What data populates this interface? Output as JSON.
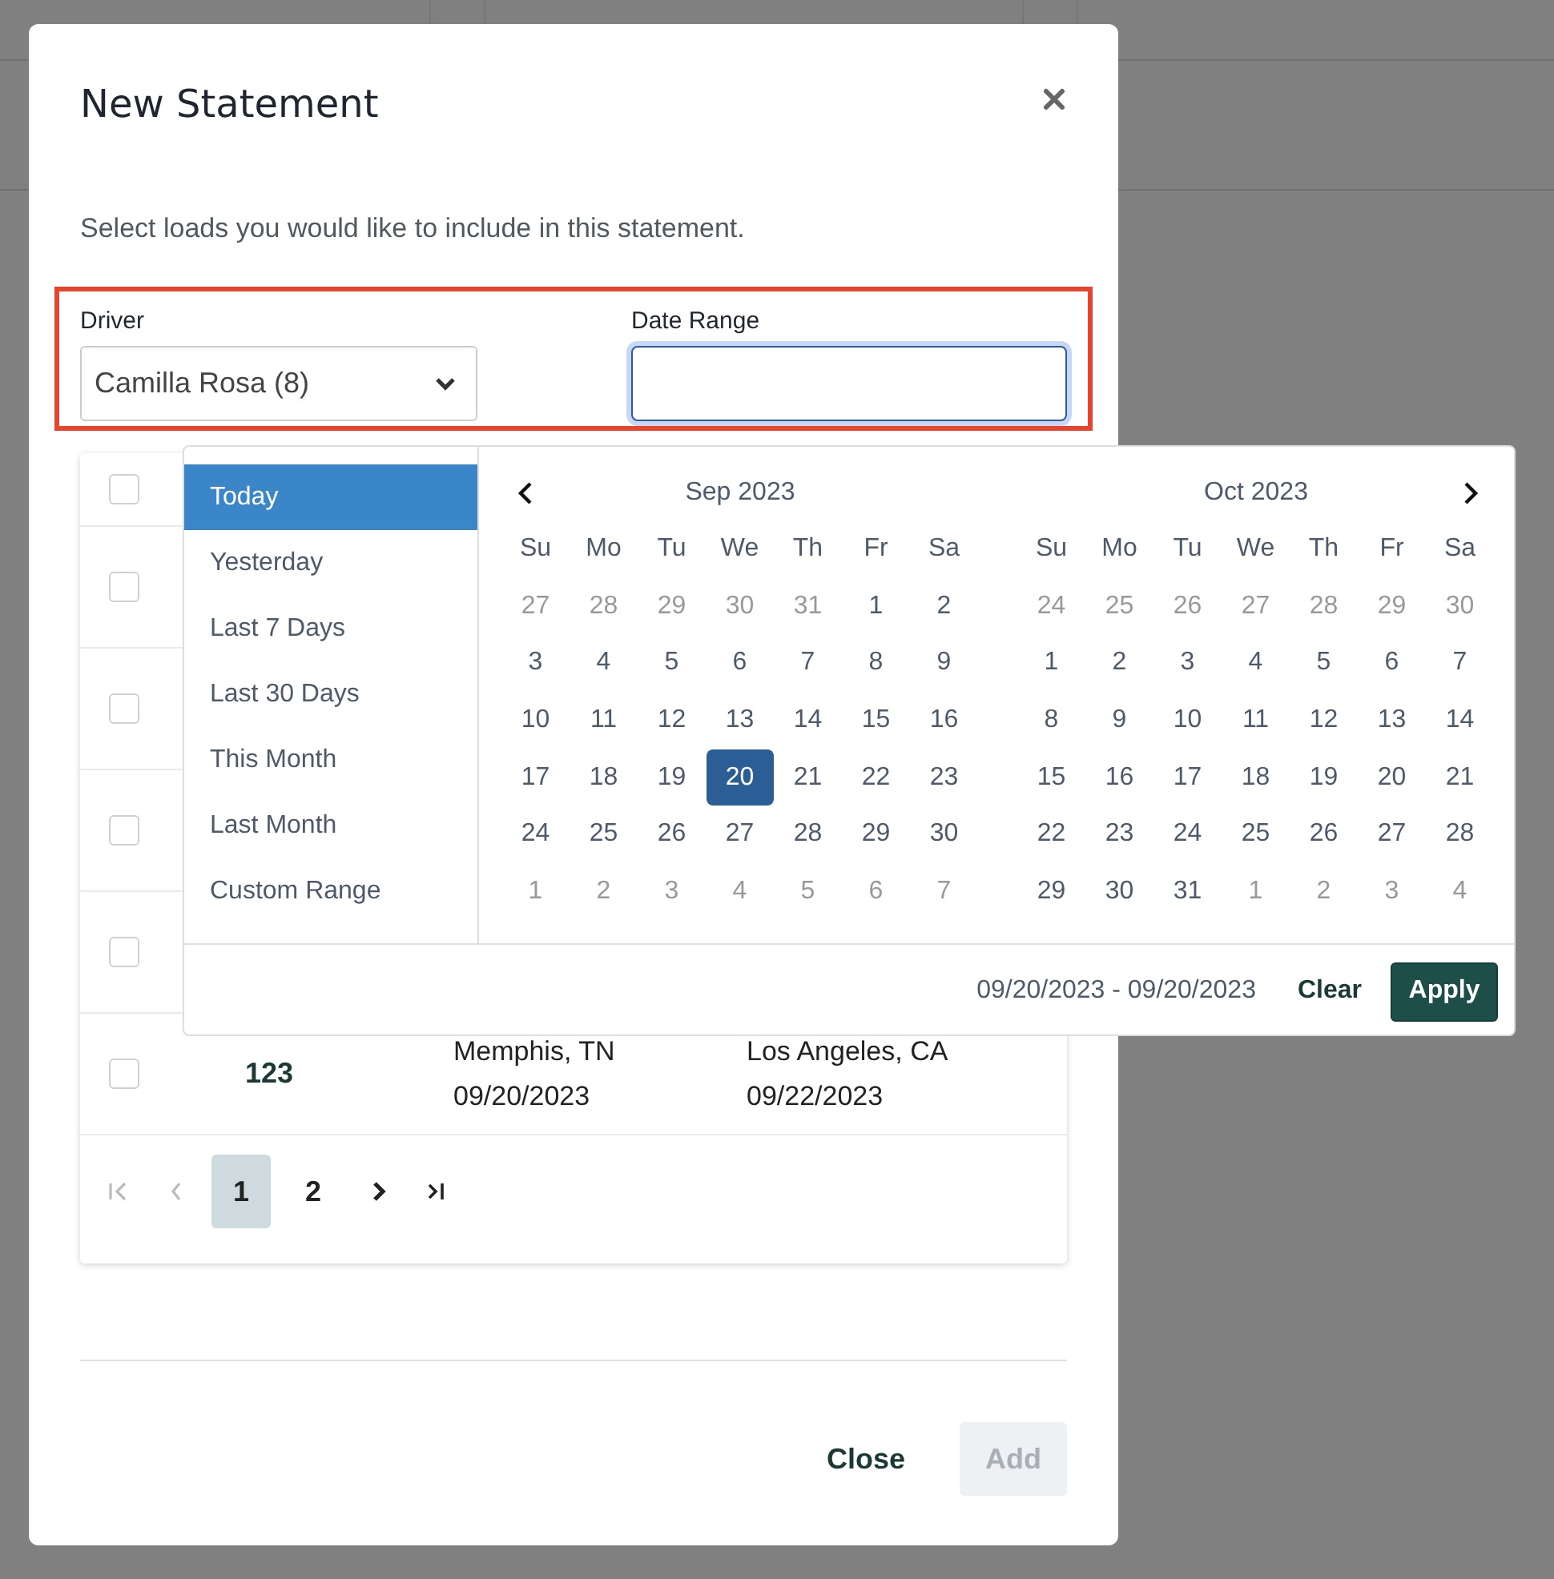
{
  "modal": {
    "title": "New Statement",
    "description": "Select loads you would like to include in this statement.",
    "driver": {
      "label": "Driver",
      "value": "Camilla Rosa (8)"
    },
    "date_range": {
      "label": "Date Range",
      "focused": true
    },
    "table": {
      "header_checkbox": {
        "checked": false
      },
      "rows": [
        {
          "checked": false
        },
        {
          "checked": false
        },
        {
          "checked": false
        },
        {
          "checked": false
        },
        {
          "checked": false,
          "column_2": "123",
          "column_3": [
            "Memphis, TN",
            "09/20/2023"
          ],
          "column_4": [
            "Los Angeles, CA",
            "09/22/2023"
          ]
        }
      ],
      "pagination": {
        "first": {
          "disabled": true
        },
        "prev": {
          "disabled": true
        },
        "pages": [
          {
            "label": "1",
            "selected": true
          },
          {
            "label": "2",
            "selected": false
          }
        ],
        "next": {
          "disabled": false
        },
        "last": {
          "disabled": false
        }
      }
    },
    "buttons": [
      {
        "label": "Close",
        "kind": "text",
        "disabled": false
      },
      {
        "label": "Add",
        "kind": "primary",
        "disabled": true
      }
    ]
  },
  "date_picker": {
    "ranges": [
      {
        "label": "Today",
        "selected": true
      },
      {
        "label": "Yesterday",
        "selected": false
      },
      {
        "label": "Last 7 Days",
        "selected": false
      },
      {
        "label": "Last 30 Days",
        "selected": false
      },
      {
        "label": "This Month",
        "selected": false
      },
      {
        "label": "Last Month",
        "selected": false
      },
      {
        "label": "Custom Range",
        "selected": false
      }
    ],
    "months": [
      {
        "title": "Sep 2023",
        "prev_arrow": true,
        "weekdays": [
          "Su",
          "Mo",
          "Tu",
          "We",
          "Th",
          "Fr",
          "Sa"
        ],
        "weeks": [
          [
            {
              "day": "27",
              "muted": true,
              "selected": false
            },
            {
              "day": "28",
              "muted": true,
              "selected": false
            },
            {
              "day": "29",
              "muted": true,
              "selected": false
            },
            {
              "day": "30",
              "muted": true,
              "selected": false
            },
            {
              "day": "31",
              "muted": true,
              "selected": false
            },
            {
              "day": "1",
              "muted": false,
              "selected": false
            },
            {
              "day": "2",
              "muted": false,
              "selected": false
            }
          ],
          [
            {
              "day": "3",
              "muted": false,
              "selected": false
            },
            {
              "day": "4",
              "muted": false,
              "selected": false
            },
            {
              "day": "5",
              "muted": false,
              "selected": false
            },
            {
              "day": "6",
              "muted": false,
              "selected": false
            },
            {
              "day": "7",
              "muted": false,
              "selected": false
            },
            {
              "day": "8",
              "muted": false,
              "selected": false
            },
            {
              "day": "9",
              "muted": false,
              "selected": false
            }
          ],
          [
            {
              "day": "10",
              "muted": false,
              "selected": false
            },
            {
              "day": "11",
              "muted": false,
              "selected": false
            },
            {
              "day": "12",
              "muted": false,
              "selected": false
            },
            {
              "day": "13",
              "muted": false,
              "selected": false
            },
            {
              "day": "14",
              "muted": false,
              "selected": false
            },
            {
              "day": "15",
              "muted": false,
              "selected": false
            },
            {
              "day": "16",
              "muted": false,
              "selected": false
            }
          ],
          [
            {
              "day": "17",
              "muted": false,
              "selected": false
            },
            {
              "day": "18",
              "muted": false,
              "selected": false
            },
            {
              "day": "19",
              "muted": false,
              "selected": false
            },
            {
              "day": "20",
              "muted": false,
              "selected": true
            },
            {
              "day": "21",
              "muted": false,
              "selected": false
            },
            {
              "day": "22",
              "muted": false,
              "selected": false
            },
            {
              "day": "23",
              "muted": false,
              "selected": false
            }
          ],
          [
            {
              "day": "24",
              "muted": false,
              "selected": false
            },
            {
              "day": "25",
              "muted": false,
              "selected": false
            },
            {
              "day": "26",
              "muted": false,
              "selected": false
            },
            {
              "day": "27",
              "muted": false,
              "selected": false
            },
            {
              "day": "28",
              "muted": false,
              "selected": false
            },
            {
              "day": "29",
              "muted": false,
              "selected": false
            },
            {
              "day": "30",
              "muted": false,
              "selected": false
            }
          ],
          [
            {
              "day": "1",
              "muted": true,
              "selected": false
            },
            {
              "day": "2",
              "muted": true,
              "selected": false
            },
            {
              "day": "3",
              "muted": true,
              "selected": false
            },
            {
              "day": "4",
              "muted": true,
              "selected": false
            },
            {
              "day": "5",
              "muted": true,
              "selected": false
            },
            {
              "day": "6",
              "muted": true,
              "selected": false
            },
            {
              "day": "7",
              "muted": true,
              "selected": false
            }
          ]
        ]
      },
      {
        "title": "Oct 2023",
        "next_arrow": true,
        "weekdays": [
          "Su",
          "Mo",
          "Tu",
          "We",
          "Th",
          "Fr",
          "Sa"
        ],
        "weeks": [
          [
            {
              "day": "24",
              "muted": true,
              "selected": false
            },
            {
              "day": "25",
              "muted": true,
              "selected": false
            },
            {
              "day": "26",
              "muted": true,
              "selected": false
            },
            {
              "day": "27",
              "muted": true,
              "selected": false
            },
            {
              "day": "28",
              "muted": true,
              "selected": false
            },
            {
              "day": "29",
              "muted": true,
              "selected": false
            },
            {
              "day": "30",
              "muted": true,
              "selected": false
            }
          ],
          [
            {
              "day": "1",
              "muted": false,
              "selected": false
            },
            {
              "day": "2",
              "muted": false,
              "selected": false
            },
            {
              "day": "3",
              "muted": false,
              "selected": false
            },
            {
              "day": "4",
              "muted": false,
              "selected": false
            },
            {
              "day": "5",
              "muted": false,
              "selected": false
            },
            {
              "day": "6",
              "muted": false,
              "selected": false
            },
            {
              "day": "7",
              "muted": false,
              "selected": false
            }
          ],
          [
            {
              "day": "8",
              "muted": false,
              "selected": false
            },
            {
              "day": "9",
              "muted": false,
              "selected": false
            },
            {
              "day": "10",
              "muted": false,
              "selected": false
            },
            {
              "day": "11",
              "muted": false,
              "selected": false
            },
            {
              "day": "12",
              "muted": false,
              "selected": false
            },
            {
              "day": "13",
              "muted": false,
              "selected": false
            },
            {
              "day": "14",
              "muted": false,
              "selected": false
            }
          ],
          [
            {
              "day": "15",
              "muted": false,
              "selected": false
            },
            {
              "day": "16",
              "muted": false,
              "selected": false
            },
            {
              "day": "17",
              "muted": false,
              "selected": false
            },
            {
              "day": "18",
              "muted": false,
              "selected": false
            },
            {
              "day": "19",
              "muted": false,
              "selected": false
            },
            {
              "day": "20",
              "muted": false,
              "selected": false
            },
            {
              "day": "21",
              "muted": false,
              "selected": false
            }
          ],
          [
            {
              "day": "22",
              "muted": false,
              "selected": false
            },
            {
              "day": "23",
              "muted": false,
              "selected": false
            },
            {
              "day": "24",
              "muted": false,
              "selected": false
            },
            {
              "day": "25",
              "muted": false,
              "selected": false
            },
            {
              "day": "26",
              "muted": false,
              "selected": false
            },
            {
              "day": "27",
              "muted": false,
              "selected": false
            },
            {
              "day": "28",
              "muted": false,
              "selected": false
            }
          ],
          [
            {
              "day": "29",
              "muted": false,
              "selected": false
            },
            {
              "day": "30",
              "muted": false,
              "selected": false
            },
            {
              "day": "31",
              "muted": false,
              "selected": false
            },
            {
              "day": "1",
              "muted": true,
              "selected": false
            },
            {
              "day": "2",
              "muted": true,
              "selected": false
            },
            {
              "day": "3",
              "muted": true,
              "selected": false
            },
            {
              "day": "4",
              "muted": true,
              "selected": false
            }
          ]
        ]
      }
    ],
    "selected_range": "09/20/2023 - 09/20/2023",
    "clear": "Clear",
    "apply": "Apply"
  }
}
